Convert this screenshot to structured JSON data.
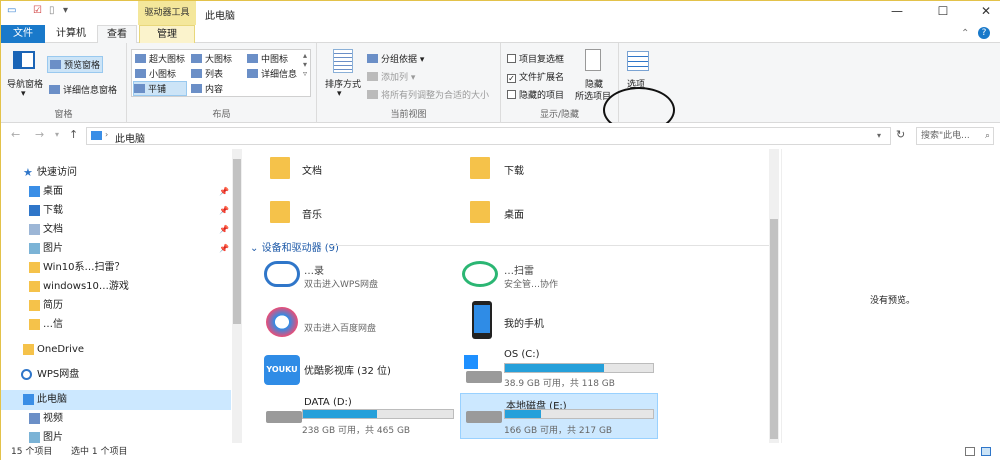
{
  "title": "此电脑",
  "context_tab": "驱动器工具",
  "window_buttons": [
    "—",
    "☐",
    "✕"
  ],
  "tabs": {
    "file": "文件",
    "computer": "计算机",
    "view": "查看",
    "manage": "管理"
  },
  "ribbon": {
    "pane": {
      "nav": "导航窗格",
      "preview": "预览窗格",
      "details": "详细信息窗格",
      "label": "窗格"
    },
    "layout": {
      "items": [
        "超大图标",
        "大图标",
        "中图标",
        "小图标",
        "列表",
        "详细信息",
        "平铺",
        "内容"
      ],
      "label": "布局"
    },
    "view": {
      "sort": "排序方式",
      "group": "分组依据",
      "addcol": "添加列",
      "fit": "将所有列调整为合适的大小",
      "label": "当前视图"
    },
    "showhide": {
      "checkboxes": "项目复选框",
      "ext": "文件扩展名",
      "hidden": "隐藏的项目",
      "hide1": "隐藏",
      "hide2": "所选项目",
      "label": "显示/隐藏"
    },
    "options": "选项"
  },
  "address": {
    "path": "此电脑",
    "search_placeholder": "搜索\"此电..."
  },
  "nav": {
    "quick": "快速访问",
    "items": [
      "桌面",
      "下载",
      "文档",
      "图片"
    ],
    "extra": [
      "Win10系…扫雷？",
      "windows10…游戏",
      "简历",
      "…信"
    ],
    "onedrive": "OneDrive",
    "wps": "WPS网盘",
    "pc": "此电脑",
    "pc_children": [
      "视频",
      "图片"
    ]
  },
  "folders": [
    "文档",
    "下载",
    "音乐",
    "桌面"
  ],
  "section": "设备和驱动器 (9)",
  "devices": [
    {
      "name": "双击进入WPS网盘",
      "sub": "…录"
    },
    {
      "name": "安全管…协作",
      "sub": "…扫雷"
    },
    {
      "name": "双击进入百度网盘",
      "sub": ""
    },
    {
      "name": "我的手机",
      "sub": ""
    },
    {
      "name": "优酷影视库 (32 位)",
      "sub": ""
    }
  ],
  "drives": [
    {
      "name": "OS (C:)",
      "info": "38.9 GB 可用，共 118 GB",
      "used": 0.67
    },
    {
      "name": "DATA (D:)",
      "info": "238 GB 可用，共 465 GB",
      "used": 0.49
    },
    {
      "name": "本地磁盘 (E:)",
      "info": "166 GB 可用，共 217 GB",
      "used": 0.24
    }
  ],
  "preview_text": "没有预览。",
  "status": {
    "count": "15 个项目",
    "selected": "选中 1 个项目"
  },
  "colors": {
    "accent": "#1979ca",
    "drive": "#26a0da",
    "selection": "#cce8ff"
  }
}
